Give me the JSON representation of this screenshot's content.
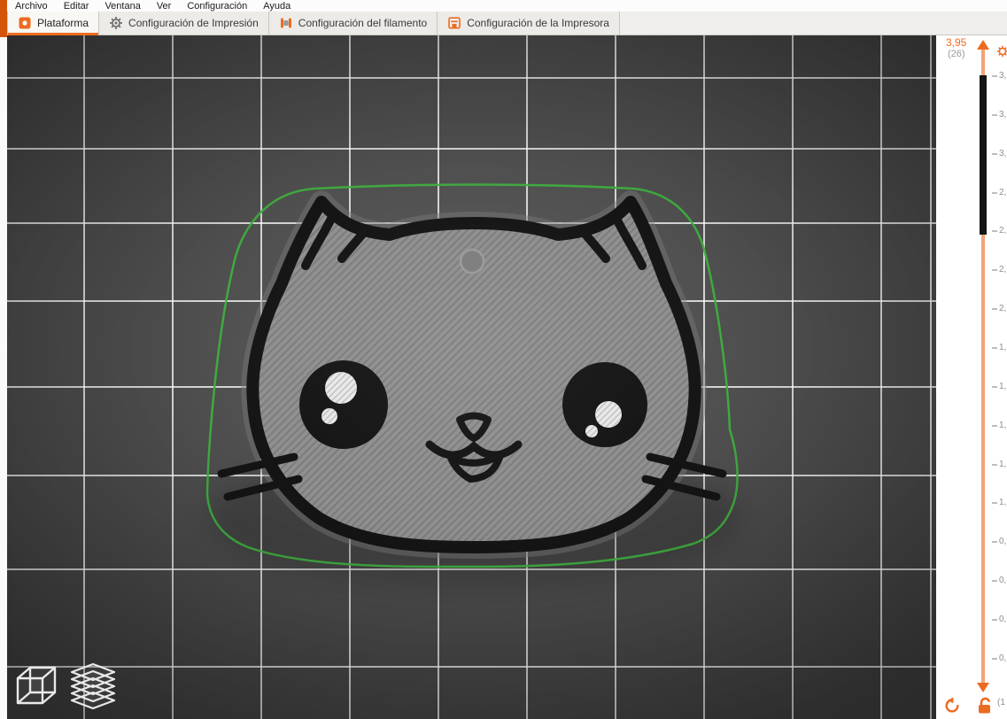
{
  "window": {
    "accent_color": "#ED6B21",
    "left_edge_accent_color": "#d4550a"
  },
  "menu": {
    "items": [
      "Archivo",
      "Editar",
      "Ventana",
      "Ver",
      "Configuración",
      "Ayuda"
    ]
  },
  "tabs": {
    "items": [
      {
        "label": "Plataforma",
        "icon": "platform-icon",
        "active": true
      },
      {
        "label": "Configuración de Impresión",
        "icon": "gear-icon",
        "active": false
      },
      {
        "label": "Configuración del filamento",
        "icon": "filament-icon",
        "active": false
      },
      {
        "label": "Configuración de la Impresora",
        "icon": "printer-icon",
        "active": false
      }
    ]
  },
  "layer_slider": {
    "current_height_mm": "3,95",
    "current_layer": "(26)",
    "tick_labels": [
      "3,",
      "3,",
      "3,",
      "2,",
      "2,",
      "2,",
      "2,",
      "1,",
      "1,",
      "1,",
      "1,",
      "1,",
      "0,",
      "0,",
      "0,",
      "0,"
    ],
    "bottom_layer_label": "(1"
  },
  "viewport": {
    "colors": {
      "plate": "#4a4a4a",
      "grid_line": "#ffffff",
      "model_infill": "#8f8f8f",
      "model_outline": "#141414",
      "skirt_line": "#3fae3f"
    }
  }
}
